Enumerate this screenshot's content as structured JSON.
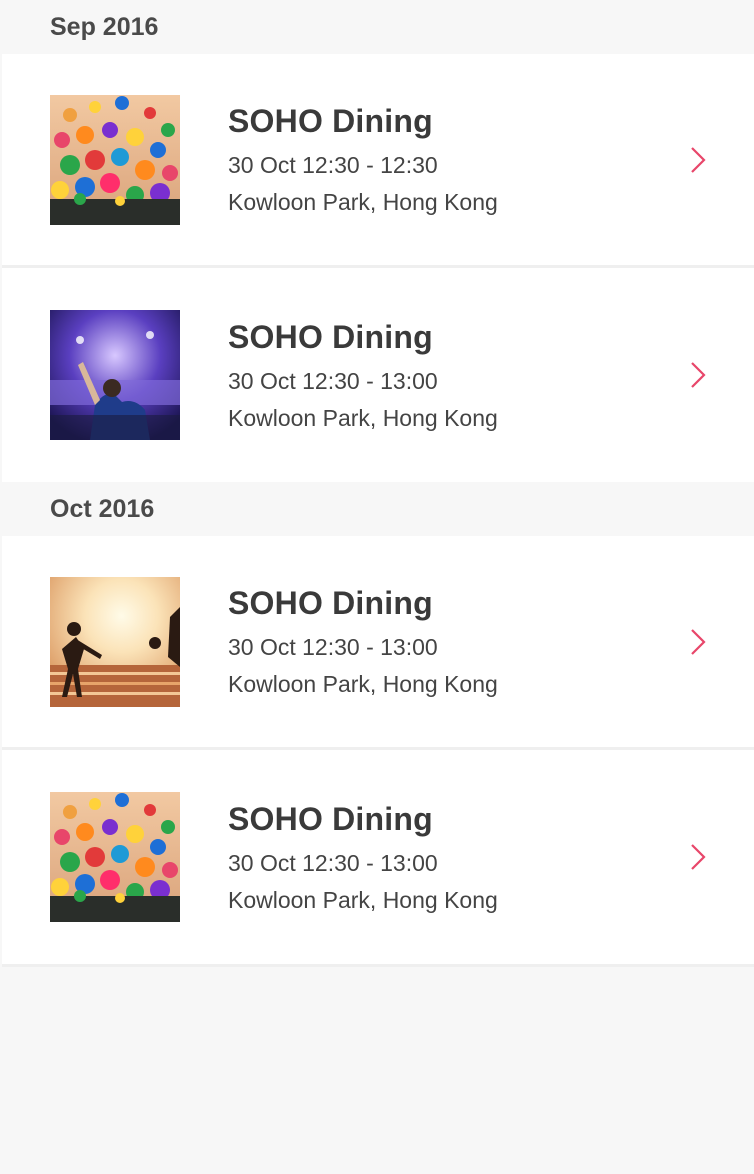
{
  "groups": [
    {
      "header": "Sep 2016",
      "events": [
        {
          "title": "SOHO Dining",
          "time": "30 Oct 12:30 - 12:30",
          "venue": "Kowloon Park, Hong Kong",
          "image": "balloons"
        },
        {
          "title": "SOHO Dining",
          "time": "30 Oct 12:30 - 13:00",
          "venue": "Kowloon Park, Hong Kong",
          "image": "dj-concert"
        }
      ]
    },
    {
      "header": "Oct 2016",
      "events": [
        {
          "title": "SOHO Dining",
          "time": "30 Oct 12:30 - 13:00",
          "venue": "Kowloon Park, Hong Kong",
          "image": "beach-football"
        },
        {
          "title": "SOHO Dining",
          "time": "30 Oct 12:30 - 13:00",
          "venue": "Kowloon Park, Hong Kong",
          "image": "balloons"
        }
      ]
    }
  ],
  "colors": {
    "accent": "#e8466a",
    "background": "#f7f7f7",
    "card": "#ffffff"
  },
  "icons": {
    "row_chevron": "chevron-right-icon"
  }
}
